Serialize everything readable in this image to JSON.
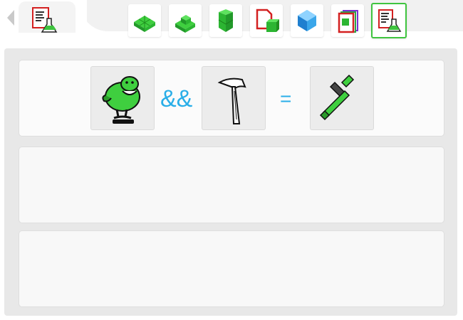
{
  "toolbar": {
    "left_tab_icon": "recipe-document-flask-icon",
    "buttons": [
      {
        "icon": "green-floor-tiles-icon",
        "active": false
      },
      {
        "icon": "green-house-blocks-icon",
        "active": false
      },
      {
        "icon": "green-wall-block-icon",
        "active": false
      },
      {
        "icon": "document-block-icon",
        "active": false
      },
      {
        "icon": "blue-crystal-icon",
        "active": false
      },
      {
        "icon": "color-documents-stack-icon",
        "active": false
      },
      {
        "icon": "recipe-document-flask-icon",
        "active": true
      }
    ]
  },
  "recipe": {
    "ingredient_1_icon": "green-spring-rider-icon",
    "operator": "&&",
    "ingredient_2_icon": "hammer-sketch-icon",
    "equals": "=",
    "result_icon": "green-hammer-icon"
  },
  "colors": {
    "accent_green": "#3fc43f",
    "operator_blue": "#29aee8",
    "panel_bg": "#fbfbfb",
    "main_bg": "#e8e8e8"
  }
}
